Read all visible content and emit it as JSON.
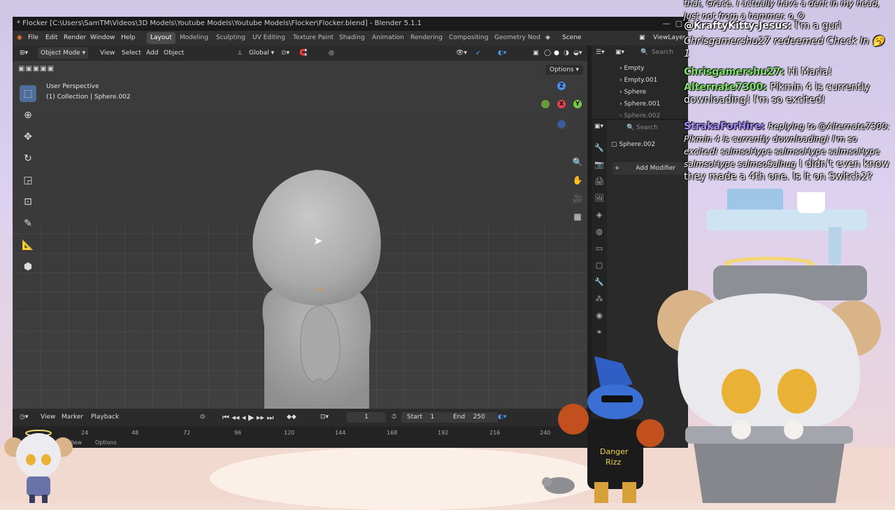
{
  "window": {
    "title": "* Flocker [C:\\Users\\SamTM\\Videos\\3D Models\\Youtube Models\\Youtube Models\\Flocker\\Flocker.blend] - Blender 5.1.1"
  },
  "menu": {
    "items": [
      "File",
      "Edit",
      "Render",
      "Window",
      "Help"
    ],
    "workspaces": [
      "Layout",
      "Modeling",
      "Sculpting",
      "UV Editing",
      "Texture Paint",
      "Shading",
      "Animation",
      "Rendering",
      "Compositing",
      "Geometry Nod"
    ],
    "active_workspace": "Layout",
    "scene": "Scene",
    "view_layer": "ViewLayer"
  },
  "viewport_header": {
    "mode": "Object Mode",
    "menus": [
      "View",
      "Select",
      "Add",
      "Object"
    ],
    "orientation": "Global",
    "options": "Options"
  },
  "viewport": {
    "perspective": "User Perspective",
    "collection": "(1) Collection | Sphere.002",
    "gizmo": {
      "z": "Z",
      "x": "X",
      "y": "Y"
    }
  },
  "timeline": {
    "menus": [
      "View",
      "Marker",
      "Playback"
    ],
    "current_frame": "1",
    "start_label": "Start",
    "start": "1",
    "end_label": "End",
    "end": "250",
    "ticks": [
      "24",
      "48",
      "72",
      "96",
      "120",
      "144",
      "168",
      "192",
      "216",
      "240"
    ],
    "footer": [
      "View",
      "Options"
    ]
  },
  "outliner": {
    "items": [
      "Empty",
      "Empty.001",
      "Sphere",
      "Sphere.001",
      "Sphere.002"
    ]
  },
  "properties": {
    "search_placeholder": "Search",
    "object": "Sphere.002",
    "add_modifier": "Add Modifier"
  },
  "chat": [
    {
      "user": "",
      "text": "that, Grace. I actually have a dent in my head, just not from a hammer. o_O"
    },
    {
      "user": "@KraftyKitty-Jesus:",
      "text": "I'm a gurl"
    },
    {
      "user": "",
      "text": "Chrisgamershu27 redeemed Check In 🥱 1"
    },
    {
      "user": "Chrisgamershu27:",
      "text": "Hi Maria!"
    },
    {
      "user": "Alternate7300:",
      "text": "Pikmin 4 is currently downloading! I'm so excited!"
    },
    {
      "user": "StrakaForHire:",
      "text": "Replying to @Alternate7300: Pikmin 4 is currently downloading! I'm so excited! salmsoHype salmsoHype salmsoHype salmsoHype salmsoSalhug",
      "text2": "I didn't even know they made a 4th one. Is it on Switch2?"
    }
  ],
  "overlay": {
    "dog_shirt": "Danger Rizz"
  },
  "colors": {
    "accent": "#4b9cf5",
    "chat_green": "#7fe36a",
    "chat_purple": "#a78bff"
  }
}
